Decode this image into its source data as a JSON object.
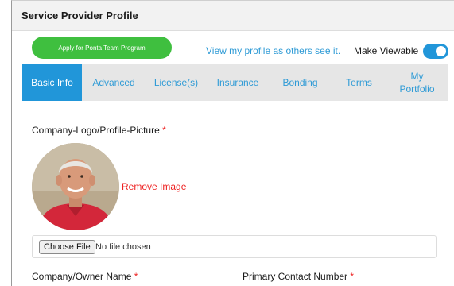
{
  "header": {
    "title": "Service Provider Profile"
  },
  "actions": {
    "apply_label": "Apply for Ponta Team Program",
    "view_profile_link": "View my profile as others see it.",
    "make_viewable_label": "Make Viewable",
    "make_viewable_on": true
  },
  "tabs": [
    {
      "label": "Basic Info",
      "active": true
    },
    {
      "label": "Advanced"
    },
    {
      "label": "License(s)"
    },
    {
      "label": "Insurance"
    },
    {
      "label": "Bonding"
    },
    {
      "label": "Terms"
    },
    {
      "label": "My Portfolio"
    }
  ],
  "form": {
    "logo_label": "Company-Logo/Profile-Picture",
    "required_mark": "*",
    "remove_image": "Remove Image",
    "choose_file": "Choose File",
    "no_file": "No file chosen",
    "company_owner_label": "Company/Owner Name",
    "primary_contact_label": "Primary Contact Number"
  },
  "colors": {
    "accent": "#2196d9",
    "apply_green": "#3fbf3f",
    "required": "#e22222"
  }
}
